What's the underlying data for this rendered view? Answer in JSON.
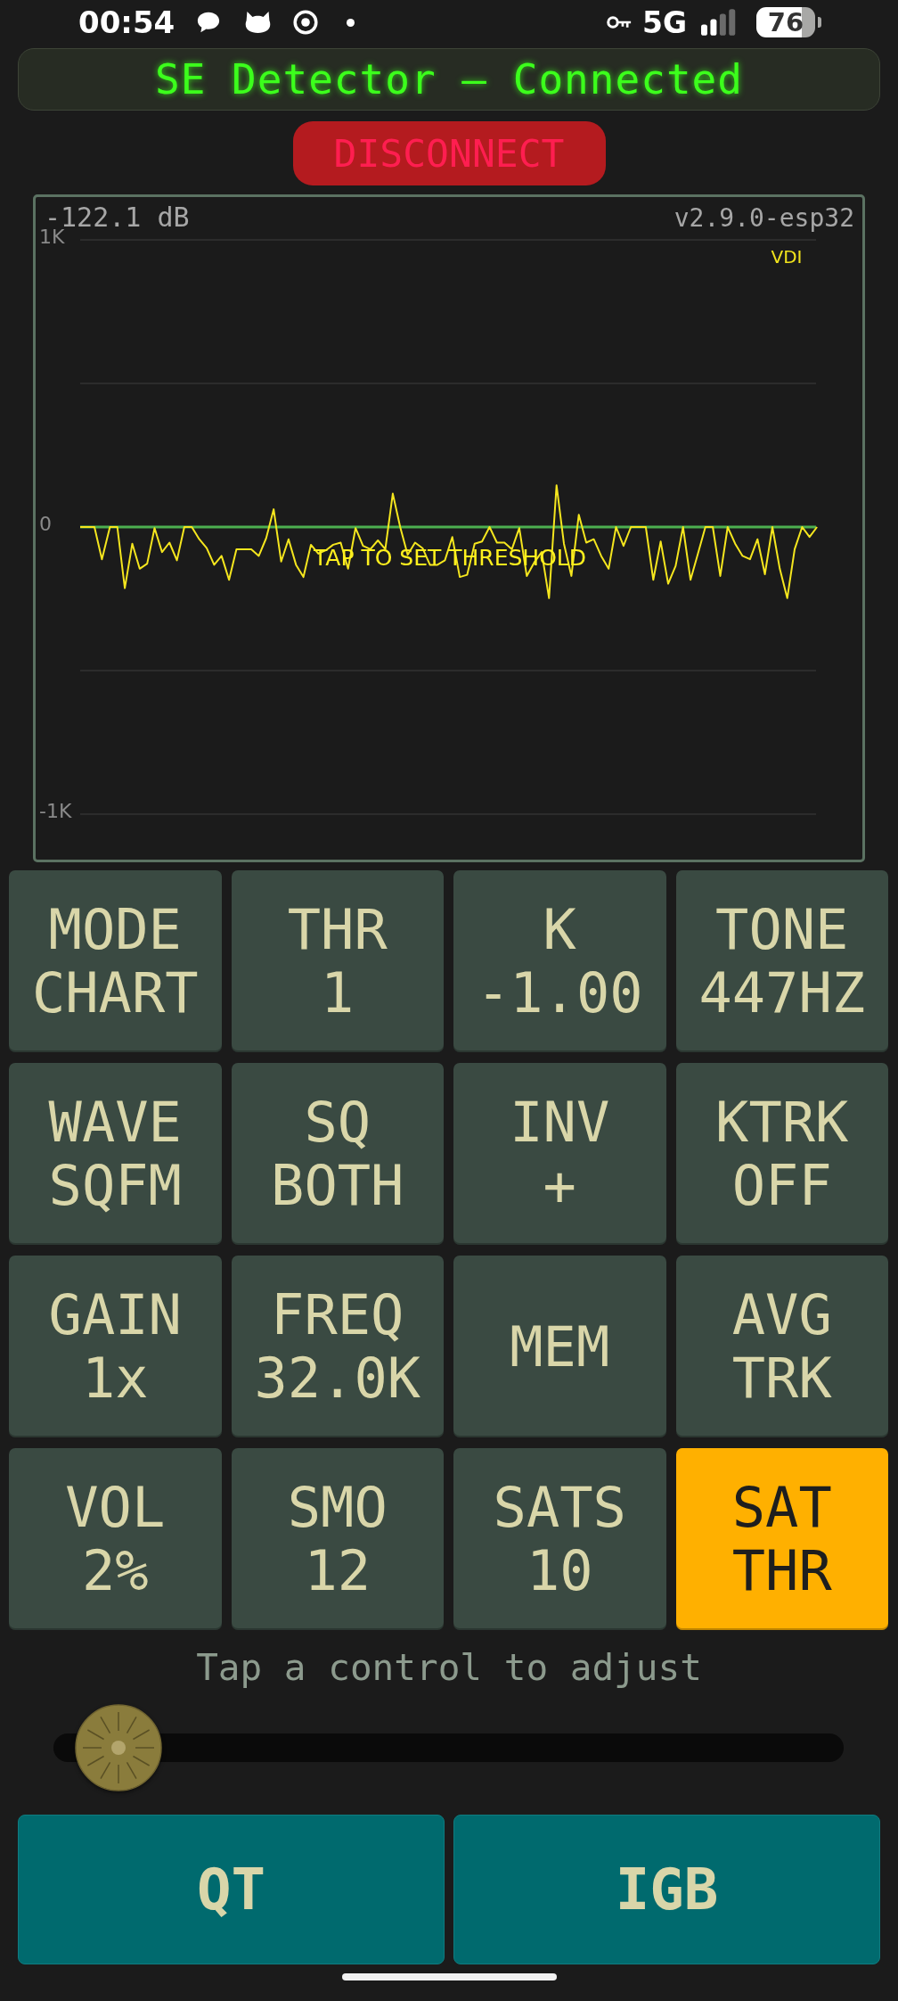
{
  "status_bar": {
    "time": "00:54",
    "network": "5G",
    "battery": "76"
  },
  "header": {
    "title": "SE Detector — Connected"
  },
  "disconnect_button": {
    "label": "DISCONNECT"
  },
  "chart": {
    "reading": "-122.1 dB",
    "version": "v2.9.0-esp32",
    "y_labels": [
      "1K",
      "0",
      "-1K"
    ],
    "legend": "VDI",
    "prompt": "TAP TO SET THRESHOLD"
  },
  "controls": [
    {
      "label": "MODE",
      "value": "CHART",
      "selected": false
    },
    {
      "label": "THR",
      "value": "1",
      "selected": false
    },
    {
      "label": "K",
      "value": "-1.00",
      "selected": false
    },
    {
      "label": "TONE",
      "value": "447HZ",
      "selected": false
    },
    {
      "label": "WAVE",
      "value": "SQFM",
      "selected": false
    },
    {
      "label": "SQ",
      "value": "BOTH",
      "selected": false
    },
    {
      "label": "INV",
      "value": "+",
      "selected": false
    },
    {
      "label": "KTRK",
      "value": "OFF",
      "selected": false
    },
    {
      "label": "GAIN",
      "value": "1x",
      "selected": false
    },
    {
      "label": "FREQ",
      "value": "32.0K",
      "selected": false
    },
    {
      "label": "MEM",
      "selected": false
    },
    {
      "label": "AVG",
      "value": "TRK",
      "selected": false
    },
    {
      "label": "VOL",
      "value": "2%",
      "selected": false
    },
    {
      "label": "SMO",
      "value": "12",
      "selected": false
    },
    {
      "label": "SATS",
      "value": "10",
      "selected": false
    },
    {
      "label": "SAT",
      "value": "THR",
      "selected": true
    }
  ],
  "hint": "Tap a control to adjust",
  "slider": {
    "level": 0.03
  },
  "actions": [
    "QT",
    "IGB"
  ]
}
